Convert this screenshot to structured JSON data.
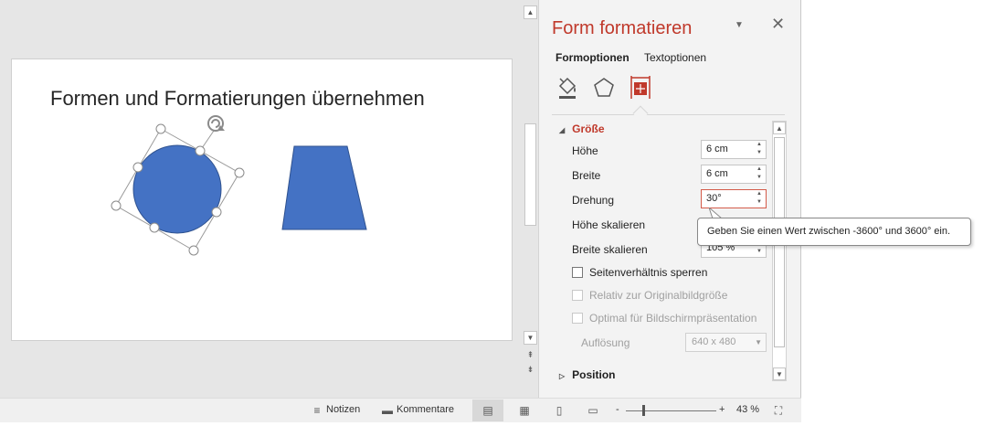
{
  "slide": {
    "title": "Formen und Formatierungen übernehmen"
  },
  "colors": {
    "accent": "#c0392b",
    "shape_fill": "#4472c4",
    "shape_stroke": "#2f528f"
  },
  "pane": {
    "title": "Form formatieren",
    "tabs": [
      "Formoptionen",
      "Textoptionen"
    ],
    "icons": [
      "fill-line-icon",
      "effects-pentagon-icon",
      "size-properties-icon"
    ],
    "section_size": "Größe",
    "fields": {
      "height_label": "Höhe",
      "height_value": "6 cm",
      "width_label": "Breite",
      "width_value": "6 cm",
      "rotation_label": "Drehung",
      "rotation_value": "30°",
      "scale_height_label": "Höhe skalieren",
      "scale_width_label": "Breite skalieren",
      "scale_width_value": "105 %"
    },
    "checkboxes": {
      "lock_aspect": "Seitenverhältnis sperren",
      "relative_original": "Relativ zur Originalbildgröße",
      "optimal_presentation": "Optimal für Bildschirmpräsentation"
    },
    "resolution_label": "Auflösung",
    "resolution_value": "640 x 480",
    "section_position": "Position"
  },
  "tooltip": {
    "text": "Geben Sie einen Wert zwischen -3600° und 3600° ein."
  },
  "statusbar": {
    "notes": "Notizen",
    "comments": "Kommentare",
    "zoom": "43 %",
    "zoom_minus": "-",
    "zoom_plus": "+"
  }
}
